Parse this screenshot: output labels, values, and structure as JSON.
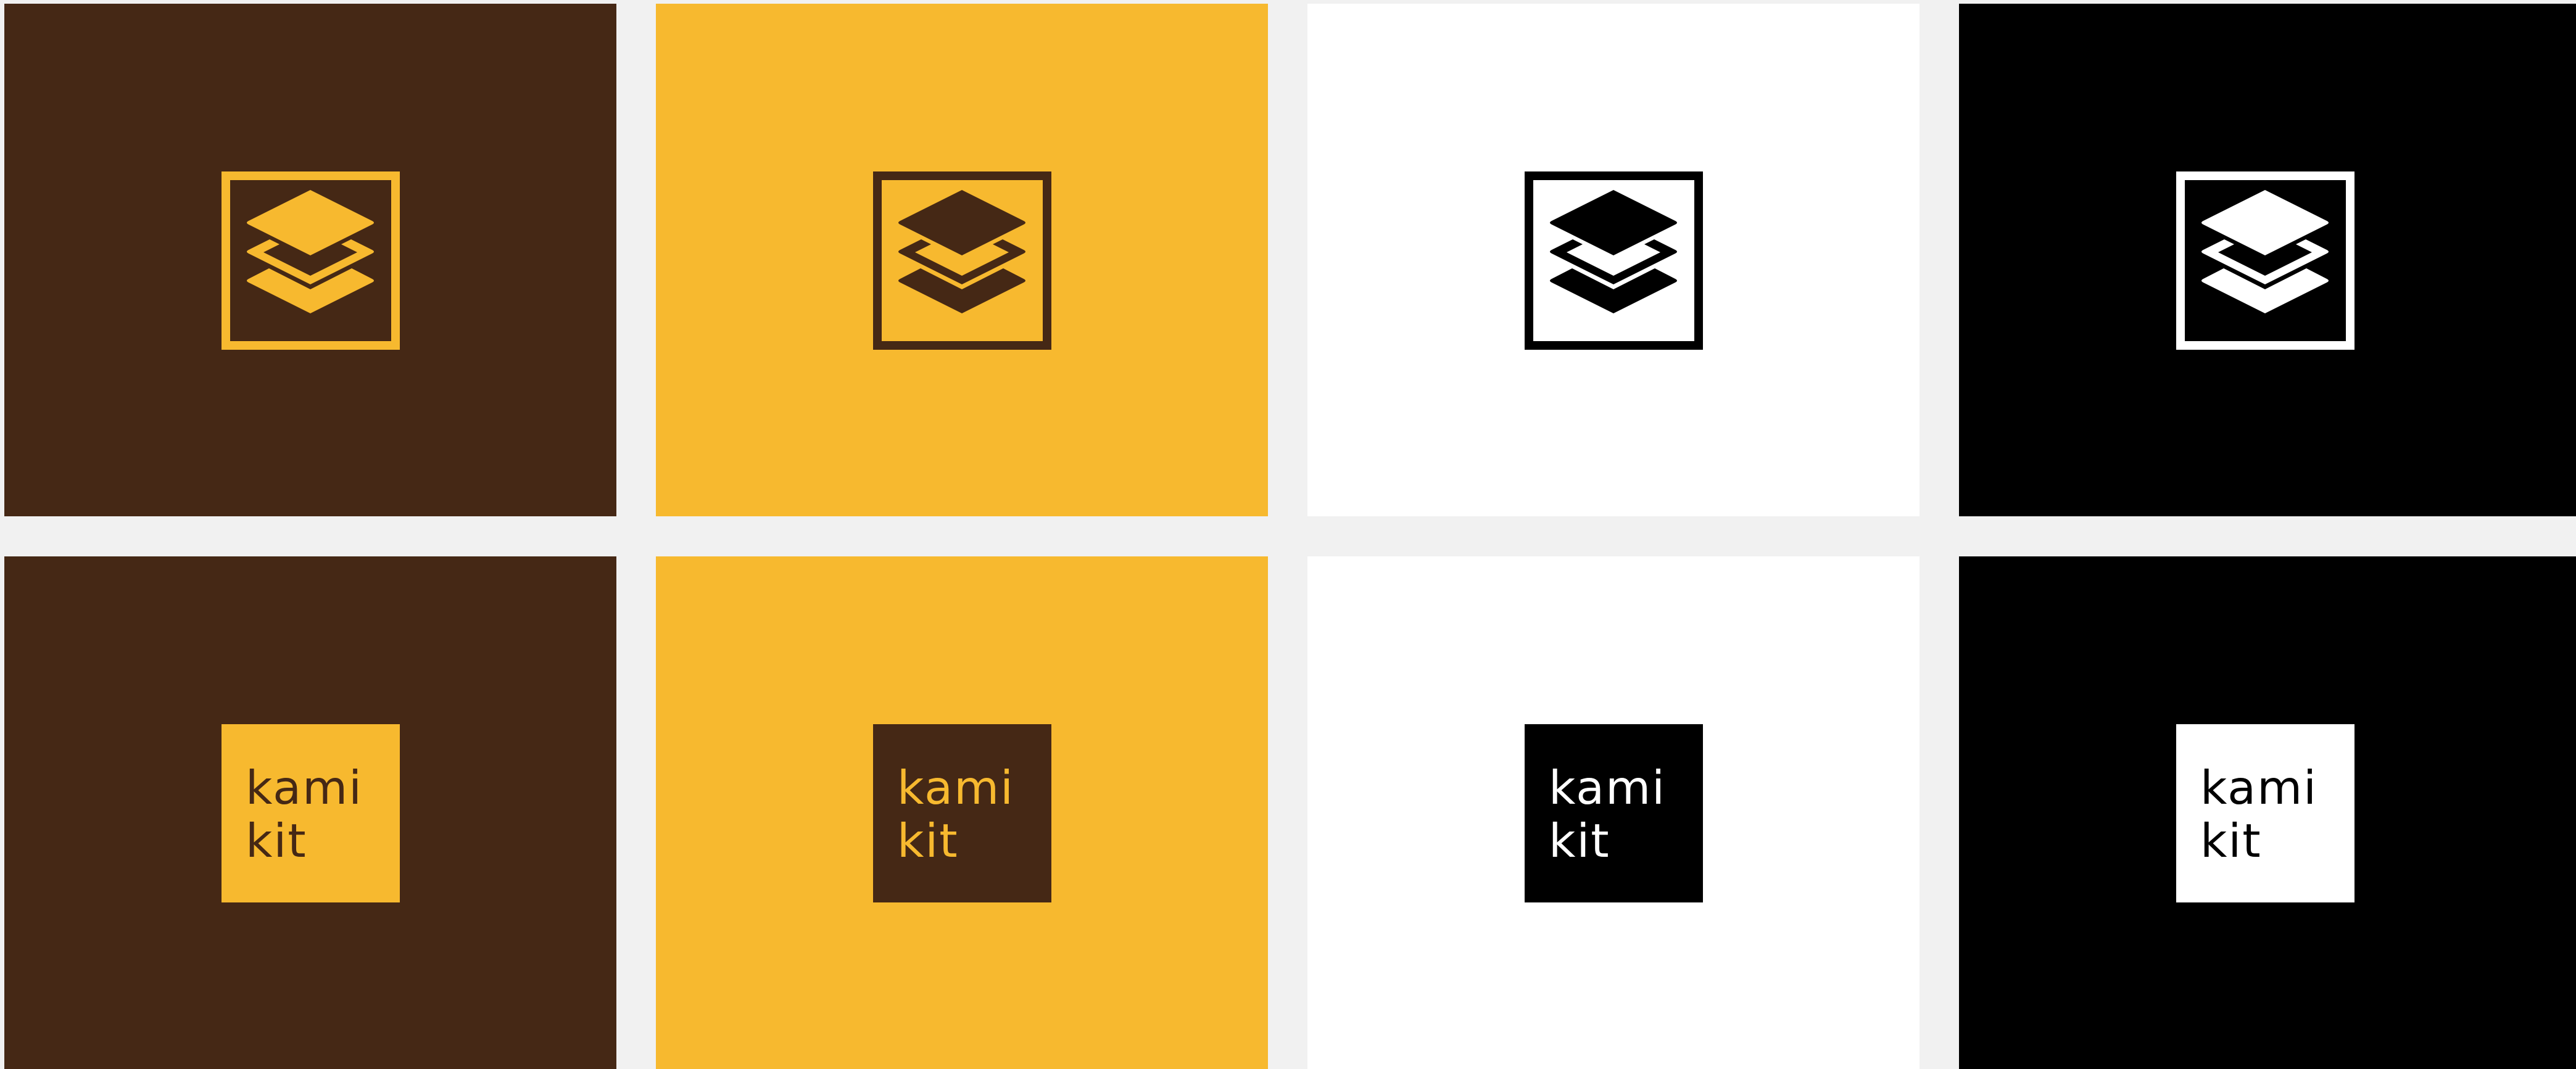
{
  "colors": {
    "brown": "#452815",
    "yellow": "#f7b92f",
    "white": "#ffffff",
    "black": "#000000",
    "gutter": "#f1f1f1"
  },
  "icon_row": [
    {
      "background": "#452815",
      "mark": "#f7b92f",
      "icon": "stacked-layers-icon"
    },
    {
      "background": "#f7b92f",
      "mark": "#452815",
      "icon": "stacked-layers-icon"
    },
    {
      "background": "#ffffff",
      "mark": "#000000",
      "icon": "stacked-layers-icon"
    },
    {
      "background": "#000000",
      "mark": "#ffffff",
      "icon": "stacked-layers-icon"
    }
  ],
  "wordmark_row": [
    {
      "background": "#452815",
      "badge": "#f7b92f",
      "text_color": "#452815"
    },
    {
      "background": "#f7b92f",
      "badge": "#452815",
      "text_color": "#f7b92f"
    },
    {
      "background": "#ffffff",
      "badge": "#000000",
      "text_color": "#ffffff"
    },
    {
      "background": "#000000",
      "badge": "#ffffff",
      "text_color": "#000000"
    }
  ],
  "wordmark": {
    "line1": "kami",
    "line2": "kit"
  }
}
